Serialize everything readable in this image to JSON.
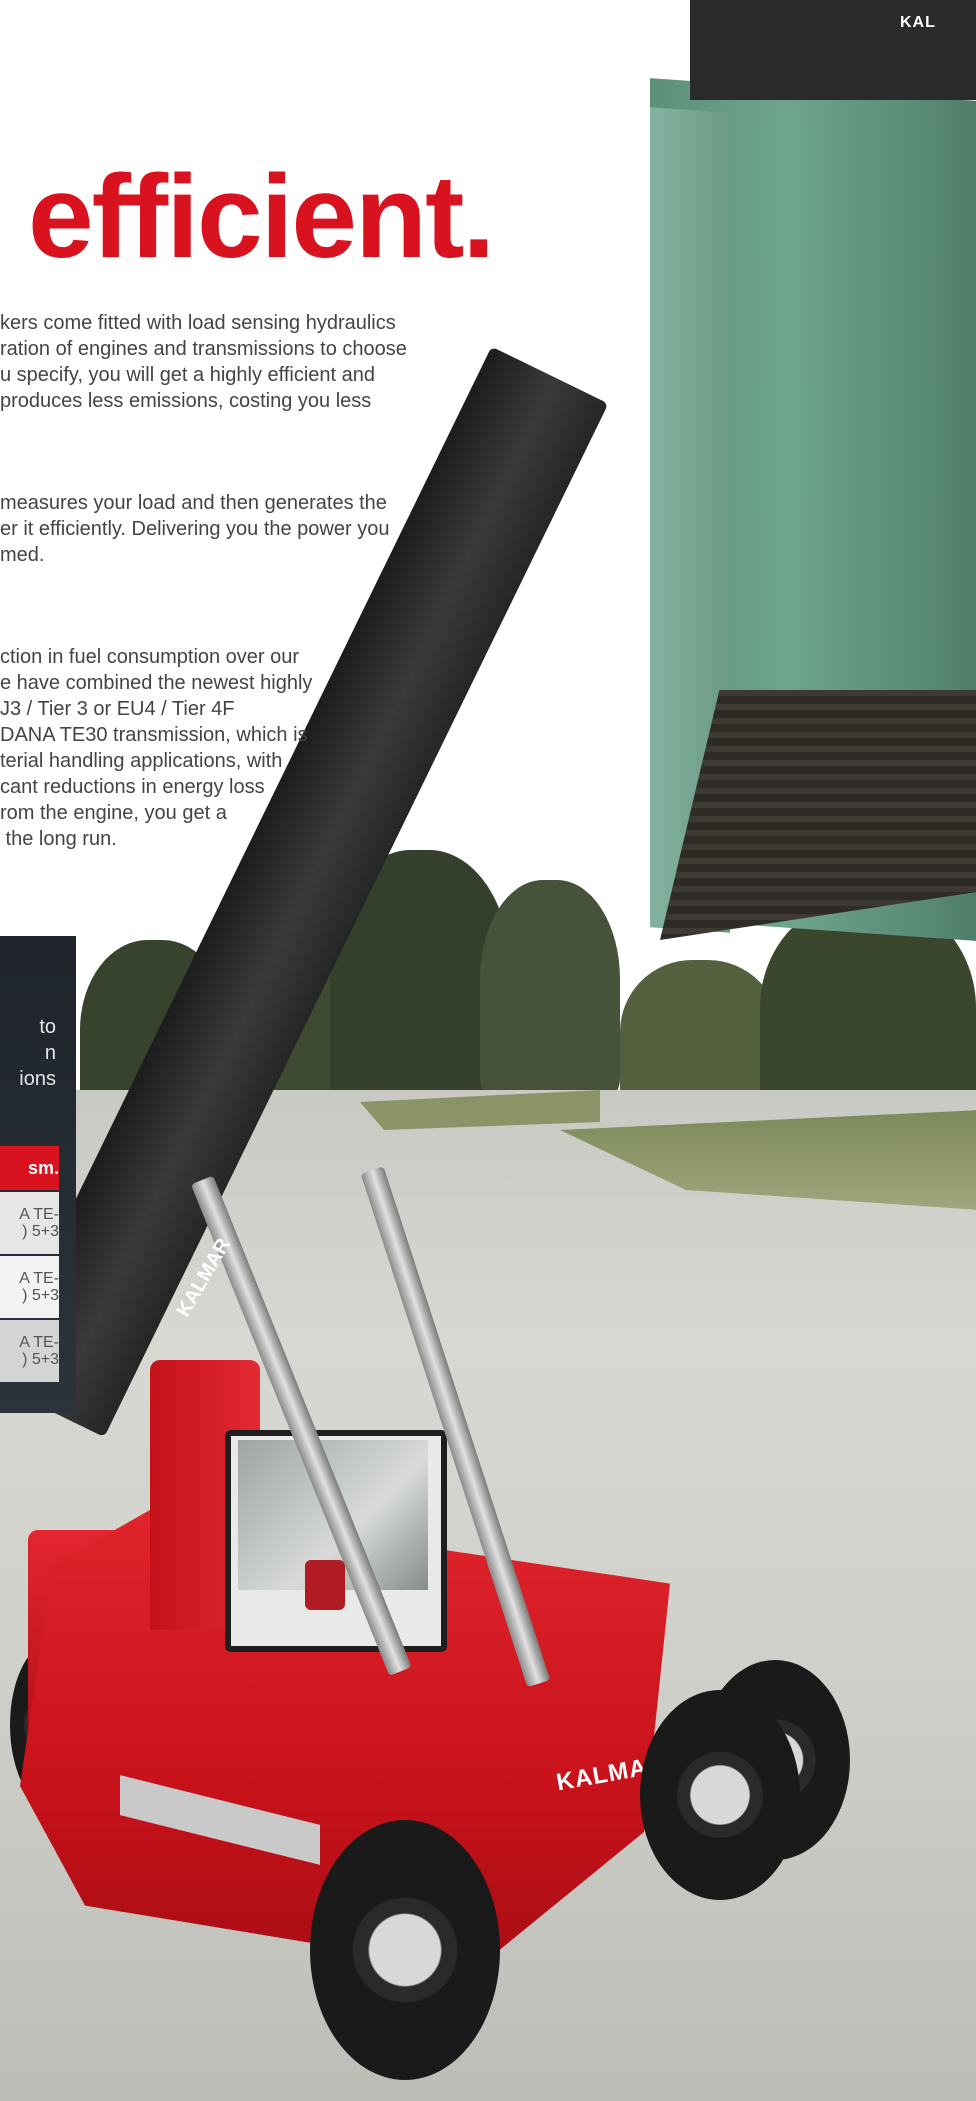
{
  "heading": "efficient.",
  "paragraphs": [
    "kers come fitted with load sensing hydraulics\nration of engines and transmissions to choose\nu specify, you will get a highly efficient and\nproduces less emissions, costing you less",
    "measures your load and then generates the\ner it efficiently. Delivering you the power you\nmed.",
    "ction in fuel consumption over our\ne have combined the newest highly\nJ3 / Tier 3 or EU4 / Tier 4F\nDANA TE30 transmission, which is\nterial handling applications, with\ncant reductions in energy loss\nrom the engine, you get a\n the long run."
  ],
  "panel": {
    "text": "to\nn\nions",
    "table_header": "sm.",
    "rows": [
      "A TE-\n) 5+3",
      "A TE-\n) 5+3",
      "A TE-\n) 5+3"
    ]
  },
  "photo": {
    "spreader_label": "KAL",
    "boom_label": "KALMAR",
    "body_label": "KALMAR"
  },
  "colors": {
    "brand_red": "#d9121f",
    "panel_dark": "#252b33"
  }
}
